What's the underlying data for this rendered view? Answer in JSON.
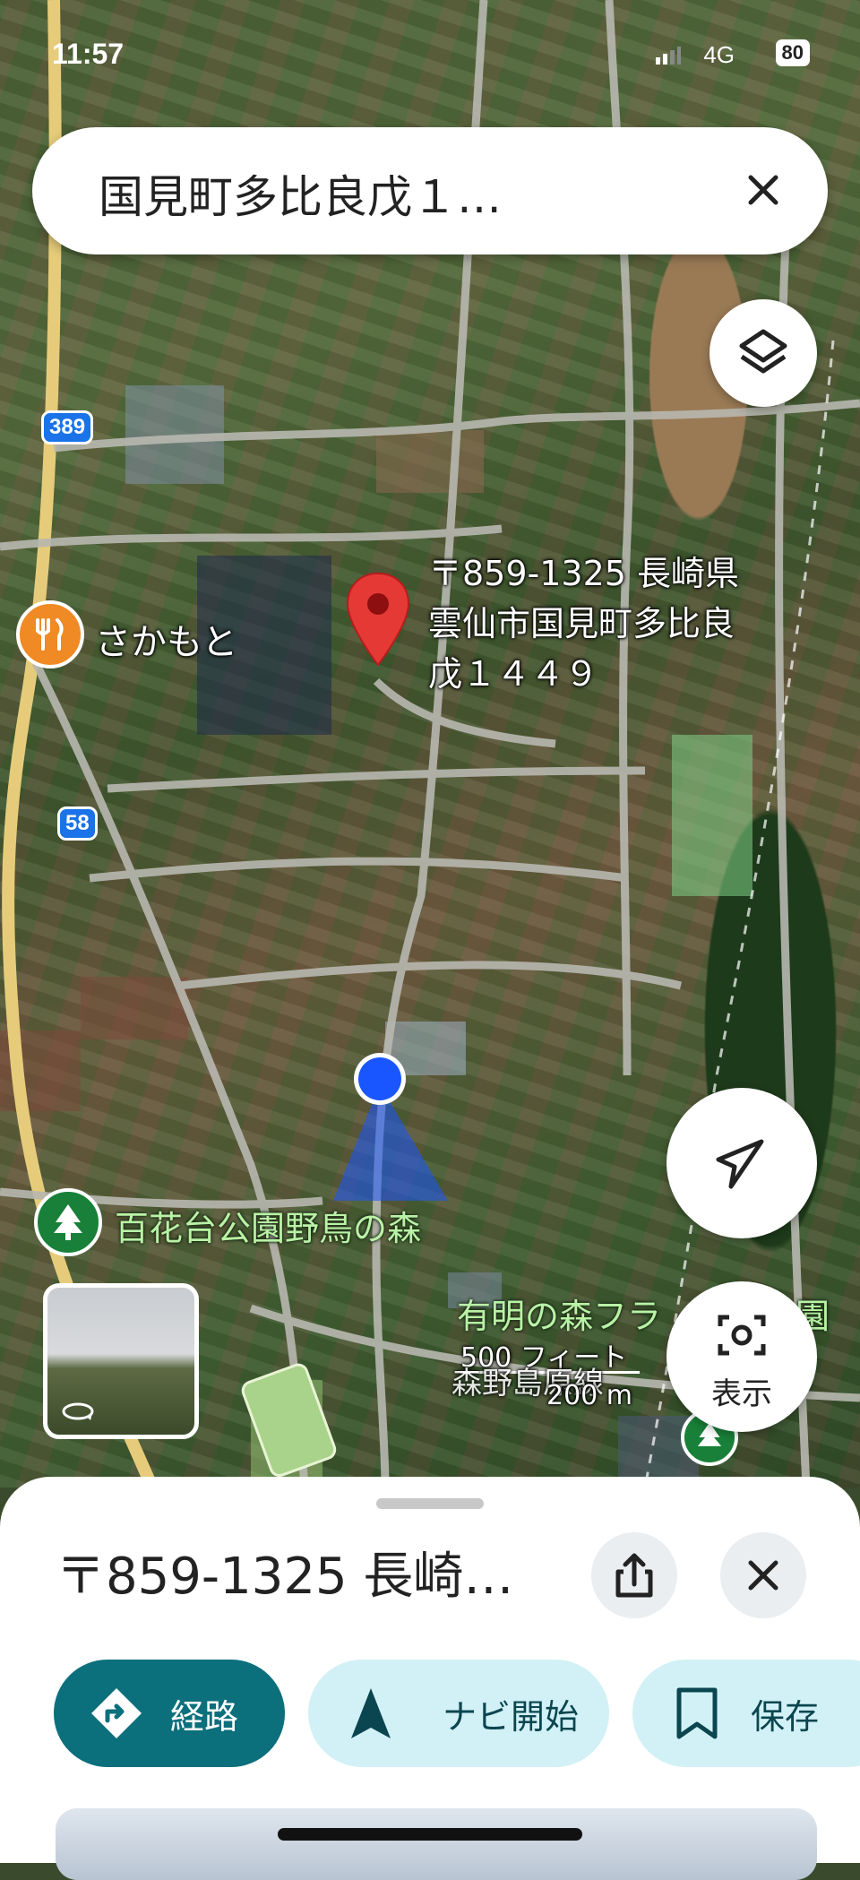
{
  "status_bar": {
    "time": "11:57",
    "network": "4G",
    "battery": "80"
  },
  "search": {
    "query": "国見町多比良戊１…"
  },
  "map": {
    "marker_label": [
      "〒859-1325 長崎県",
      "雲仙市国見町多比良",
      "戊１４４９"
    ],
    "route_shields": [
      "389",
      "58"
    ],
    "restaurant_name": "さかもと",
    "park_name": "百花台公園野鳥の森",
    "garden_name": "有明の森フラ",
    "garden_name_tail": "園",
    "railway_name": "森野島原線",
    "scale_feet": "500 フィート",
    "scale_meters": "200 m",
    "lens_label": "表示"
  },
  "sheet": {
    "title": "〒859-1325 長崎…",
    "buttons": {
      "route": "経路",
      "navi": "ナビ開始",
      "save": "保存"
    }
  },
  "colors": {
    "marker": "#e53935",
    "accent": "#0b6f7c",
    "location": "#1a56ff"
  }
}
